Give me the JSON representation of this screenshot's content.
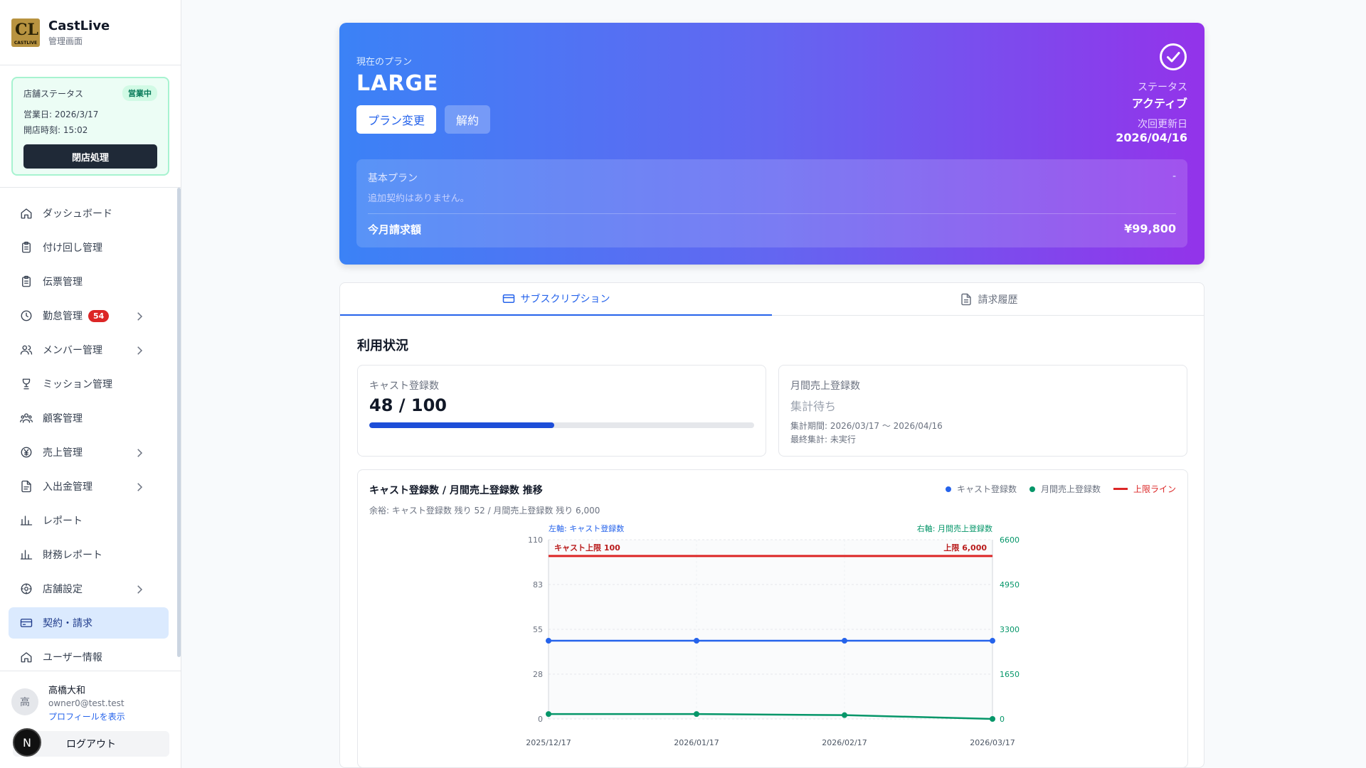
{
  "brand": {
    "logo_text": "CASTLIVE",
    "title": "CastLive",
    "subtitle": "管理画面"
  },
  "store": {
    "label": "店舗ステータス",
    "status_badge": "営業中",
    "business_day": "営業日: 2026/3/17",
    "open_time": "開店時刻: 15:02",
    "close_button": "閉店処理"
  },
  "nav": [
    {
      "label": "ダッシュボード",
      "icon": "home-icon"
    },
    {
      "label": "付け回し管理",
      "icon": "clipboard-icon"
    },
    {
      "label": "伝票管理",
      "icon": "clipboard-icon"
    },
    {
      "label": "勤怠管理",
      "icon": "clock-icon",
      "badge": "54"
    },
    {
      "label": "メンバー管理",
      "icon": "users-icon"
    },
    {
      "label": "ミッション管理",
      "icon": "trophy-icon"
    },
    {
      "label": "顧客管理",
      "icon": "customers-icon"
    },
    {
      "label": "売上管理",
      "icon": "yen-icon"
    },
    {
      "label": "入出金管理",
      "icon": "file-icon"
    },
    {
      "label": "レポート",
      "icon": "bar-chart-icon"
    },
    {
      "label": "財務レポート",
      "icon": "bar-chart-icon"
    },
    {
      "label": "店舗設定",
      "icon": "settings-icon"
    },
    {
      "label": "契約・請求",
      "icon": "credit-card-icon",
      "active": true
    },
    {
      "label": "ユーザー情報",
      "icon": "home-icon"
    }
  ],
  "user": {
    "avatar": "高",
    "name": "高橋大和",
    "email": "owner0@test.test",
    "profile_link": "プロフィールを表示",
    "logout": "ログアウト",
    "n_badge": "N"
  },
  "plan": {
    "current_label": "現在のプラン",
    "name": "LARGE",
    "change_button": "プラン変更",
    "cancel_button": "解約",
    "status_label": "ステータス",
    "status_value": "アクティブ",
    "renewal_label": "次回更新日",
    "renewal_value": "2026/04/16",
    "base_plan_label": "基本プラン",
    "base_plan_value": "-",
    "no_addons": "追加契約はありません。",
    "monthly_label": "今月請求額",
    "monthly_amount": "¥99,800"
  },
  "tabs": {
    "subscription": "サブスクリプション",
    "billing": "請求履歴"
  },
  "usage": {
    "title": "利用状況",
    "cast_label": "キャスト登録数",
    "cast_value": "48 / 100",
    "cast_progress": 0.48,
    "sales_label": "月間売上登録数",
    "sales_value": "集計待ち",
    "sales_period": "集計期間: 2026/03/17 〜 2026/04/16",
    "sales_last": "最終集計: 未実行"
  },
  "chart_data": {
    "type": "line",
    "title": "キャスト登録数 / 月間売上登録数 推移",
    "subtitle": "余裕: キャスト登録数 残り 52 / 月間売上登録数 残り 6,000",
    "categories": [
      "2025/12/17",
      "2026/01/17",
      "2026/02/17",
      "2026/03/17"
    ],
    "left_axis_label": "左軸: キャスト登録数",
    "right_axis_label": "右軸: 月間売上登録数",
    "left_ticks": [
      "110",
      "83",
      "55",
      "28",
      "0"
    ],
    "right_ticks": [
      "6600",
      "4950",
      "3300",
      "1650",
      "0"
    ],
    "ylim_left": [
      0,
      110
    ],
    "ylim_right": [
      0,
      6600
    ],
    "series": [
      {
        "name": "キャスト登録数",
        "axis": "left",
        "color": "#2563eb",
        "values": [
          48,
          48,
          48,
          48
        ]
      },
      {
        "name": "月間売上登録数",
        "axis": "right",
        "color": "#059669",
        "values": [
          180,
          180,
          140,
          0
        ]
      }
    ],
    "limit": {
      "name": "上限ライン",
      "color": "#dc2626",
      "left_value": 100,
      "left_label": "キャスト上限 100",
      "right_label": "上限 6,000"
    },
    "legend": [
      "キャスト登録数",
      "月間売上登録数",
      "上限ライン"
    ],
    "legend_position": "top-right",
    "grid": true
  }
}
